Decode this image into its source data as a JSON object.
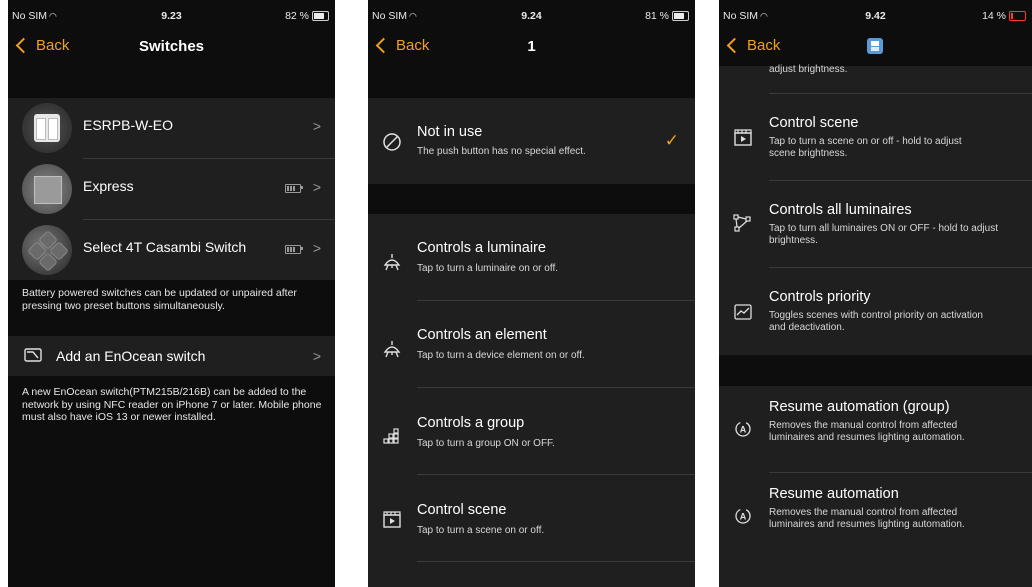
{
  "colors": {
    "accent": "#f0a020",
    "background": "#0d0d0d",
    "cell": "#1f1f1f"
  },
  "screen1": {
    "status": {
      "carrier": "No SIM",
      "time": "9.23",
      "battery": "82 %",
      "battery_level": 0.82
    },
    "nav": {
      "back": "Back",
      "title": "Switches"
    },
    "switches": [
      {
        "name": "ESRPB-W-EO",
        "icon": "wall-switch-image"
      },
      {
        "name": "Express",
        "icon": "express-switch-image",
        "battery_icon": "battery-icon"
      },
      {
        "name": "Select 4T Casambi Switch",
        "icon": "select-4t-switch-image",
        "battery_icon": "battery-icon"
      }
    ],
    "footnote1": "Battery powered switches can be updated or unpaired after pressing two preset buttons simultaneously.",
    "add_label": "Add an EnOcean switch",
    "footnote2": "A new EnOcean switch(PTM215B/216B) can be added to the network by using NFC reader on iPhone 7 or later. Mobile phone must also have iOS 13 or newer installed."
  },
  "screen2": {
    "status": {
      "carrier": "No SIM",
      "time": "9.24",
      "battery": "81 %",
      "battery_level": 0.81
    },
    "nav": {
      "back": "Back",
      "title": "1"
    },
    "not_in_use": {
      "title": "Not in use",
      "subtitle": "The push button has no special effect.",
      "selected": true,
      "icon": "not-in-use-icon"
    },
    "options": [
      {
        "title": "Controls a luminaire",
        "subtitle": "Tap to turn a luminaire on or off.",
        "icon": "luminaire-icon"
      },
      {
        "title": "Controls an element",
        "subtitle": "Tap to turn a device element on or off.",
        "icon": "element-icon"
      },
      {
        "title": "Controls a group",
        "subtitle": "Tap to turn a group ON or OFF.",
        "icon": "group-icon"
      },
      {
        "title": "Control scene",
        "subtitle": "Tap to turn a scene on or off.",
        "icon": "scene-icon"
      }
    ]
  },
  "screen3": {
    "status": {
      "carrier": "No SIM",
      "time": "9.42",
      "battery": "14 %",
      "battery_level": 0.14
    },
    "nav": {
      "back": "Back",
      "title_icon": "switch-badge-icon"
    },
    "clipped_text": "adjust brightness.",
    "options": [
      {
        "title": "Control scene",
        "subtitle": "Tap to turn a scene on or off - hold to adjust scene brightness.",
        "icon": "scene-icon"
      },
      {
        "title": "Controls all luminaires",
        "subtitle": "Tap to turn all luminaires ON or OFF - hold to adjust brightness.",
        "icon": "all-luminaires-icon"
      },
      {
        "title": "Controls priority",
        "subtitle": "Toggles scenes with control priority on activation and deactivation.",
        "icon": "priority-icon"
      }
    ],
    "automation": [
      {
        "title": "Resume automation (group)",
        "subtitle": "Removes the manual control from affected luminaires and resumes lighting automation.",
        "icon": "automation-icon"
      },
      {
        "title": "Resume automation",
        "subtitle": "Removes the manual control from affected luminaires and resumes lighting automation.",
        "icon": "automation-icon"
      }
    ]
  }
}
